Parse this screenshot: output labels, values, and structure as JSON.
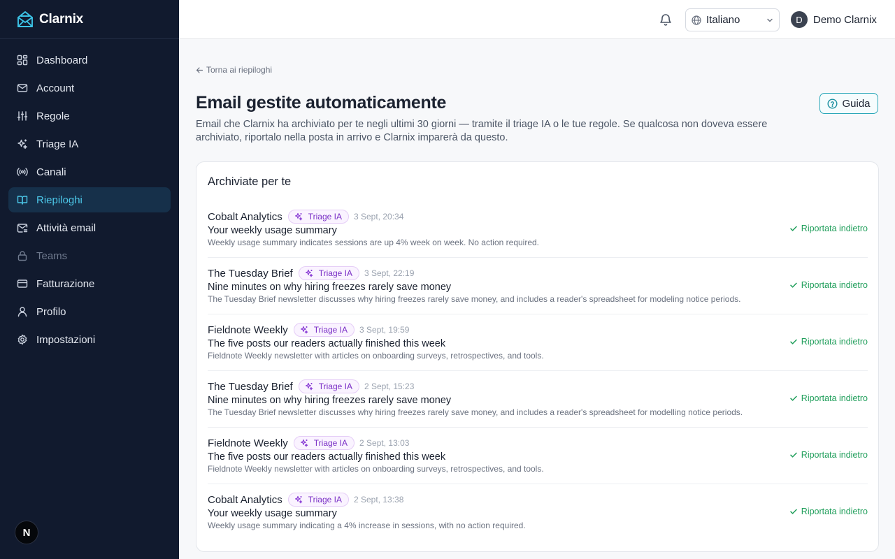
{
  "app": {
    "name": "Clarnix"
  },
  "sidebar": {
    "items": [
      {
        "label": "Dashboard",
        "icon": "dashboard-icon",
        "state": "normal"
      },
      {
        "label": "Account",
        "icon": "mail-icon",
        "state": "normal"
      },
      {
        "label": "Regole",
        "icon": "sliders-icon",
        "state": "normal"
      },
      {
        "label": "Triage IA",
        "icon": "sparkles-icon",
        "state": "normal"
      },
      {
        "label": "Canali",
        "icon": "radio-icon",
        "state": "normal"
      },
      {
        "label": "Riepiloghi",
        "icon": "book-open-icon",
        "state": "active"
      },
      {
        "label": "Attività email",
        "icon": "mail-activity-icon",
        "state": "normal"
      },
      {
        "label": "Teams",
        "icon": "lock-icon",
        "state": "disabled"
      },
      {
        "label": "Fatturazione",
        "icon": "credit-card-icon",
        "state": "normal"
      },
      {
        "label": "Profilo",
        "icon": "user-icon",
        "state": "normal"
      },
      {
        "label": "Impostazioni",
        "icon": "gear-icon",
        "state": "normal"
      }
    ],
    "bottom_avatar": "N"
  },
  "topbar": {
    "language": "Italiano",
    "user_initial": "D",
    "user_name": "Demo Clarnix"
  },
  "main": {
    "back_link": "Torna ai riepiloghi",
    "title": "Email gestite automaticamente",
    "description": "Email che Clarnix ha archiviato per te negli ultimi 30 giorni — tramite il triage IA o le tue regole. Se qualcosa non doveva essere archiviato, riportalo nella posta in arrivo e Clarnix imparerà da questo.",
    "guide_button": "Guida",
    "card_title": "Archiviate per te",
    "emails": [
      {
        "sender": "Cobalt Analytics",
        "badge": "Triage IA",
        "date": "3 Sept, 20:34",
        "subject": "Your weekly usage summary",
        "summary": "Weekly usage summary indicates sessions are up 4% week on week. No action required.",
        "status": "Riportata indietro"
      },
      {
        "sender": "The Tuesday Brief",
        "badge": "Triage IA",
        "date": "3 Sept, 22:19",
        "subject": "Nine minutes on why hiring freezes rarely save money",
        "summary": "The Tuesday Brief newsletter discusses why hiring freezes rarely save money, and includes a reader's spreadsheet for modeling notice periods.",
        "status": "Riportata indietro"
      },
      {
        "sender": "Fieldnote Weekly",
        "badge": "Triage IA",
        "date": "3 Sept, 19:59",
        "subject": "The five posts our readers actually finished this week",
        "summary": "Fieldnote Weekly newsletter with articles on onboarding surveys, retrospectives, and tools.",
        "status": "Riportata indietro"
      },
      {
        "sender": "The Tuesday Brief",
        "badge": "Triage IA",
        "date": "2 Sept, 15:23",
        "subject": "Nine minutes on why hiring freezes rarely save money",
        "summary": "The Tuesday Brief newsletter discusses why hiring freezes rarely save money, and includes a reader's spreadsheet for modelling notice periods.",
        "status": "Riportata indietro"
      },
      {
        "sender": "Fieldnote Weekly",
        "badge": "Triage IA",
        "date": "2 Sept, 13:03",
        "subject": "The five posts our readers actually finished this week",
        "summary": "Fieldnote Weekly newsletter with articles on onboarding surveys, retrospectives, and tools.",
        "status": "Riportata indietro"
      },
      {
        "sender": "Cobalt Analytics",
        "badge": "Triage IA",
        "date": "2 Sept, 13:38",
        "subject": "Your weekly usage summary",
        "summary": "Weekly usage summary indicating a 4% increase in sessions, with no action required.",
        "status": "Riportata indietro"
      }
    ]
  },
  "colors": {
    "sidebar_bg": "#111a2e",
    "active_accent": "#4cc7e8",
    "badge_purple": "#7a2fc6",
    "status_green": "#1f9e5a",
    "guide_border": "#2aa7b8"
  }
}
